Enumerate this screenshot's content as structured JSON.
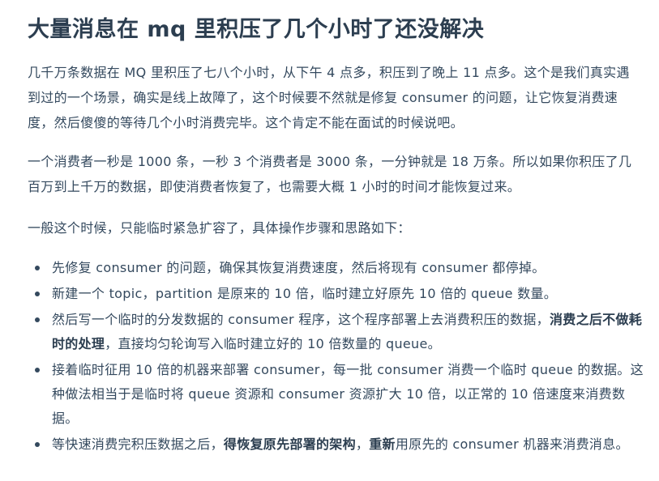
{
  "title": "大量消息在 mq 里积压了几个小时了还没解决",
  "paragraphs": [
    "几千万条数据在 MQ 里积压了七八个小时，从下午 4 点多，积压到了晚上 11 点多。这个是我们真实遇到过的一个场景，确实是线上故障了，这个时候要不然就是修复 consumer 的问题，让它恢复消费速度，然后傻傻的等待几个小时消费完毕。这个肯定不能在面试的时候说吧。",
    "一个消费者一秒是 1000 条，一秒 3 个消费者是 3000 条，一分钟就是 18 万条。所以如果你积压了几百万到上千万的数据，即使消费者恢复了，也需要大概 1 小时的时间才能恢复过来。",
    "一般这个时候，只能临时紧急扩容了，具体操作步骤和思路如下："
  ],
  "list": [
    {
      "before": "先修复 consumer 的问题，确保其恢复消费速度，然后将现有 consumer 都停掉。",
      "bold": "",
      "after": "",
      "bold2": "",
      "after2": ""
    },
    {
      "before": "新建一个 topic，partition 是原来的 10 倍，临时建立好原先 10 倍的 queue 数量。",
      "bold": "",
      "after": "",
      "bold2": "",
      "after2": ""
    },
    {
      "before": "然后写一个临时的分发数据的 consumer 程序，这个程序部署上去消费积压的数据，",
      "bold": "消费之后不做耗时的处理",
      "after": "，直接均匀轮询写入临时建立好的 10 倍数量的 queue。",
      "bold2": "",
      "after2": ""
    },
    {
      "before": "接着临时征用 10 倍的机器来部署 consumer，每一批 consumer 消费一个临时 queue 的数据。这种做法相当于是临时将 queue 资源和 consumer 资源扩大 10 倍，以正常的 10 倍速度来消费数据。",
      "bold": "",
      "after": "",
      "bold2": "",
      "after2": ""
    },
    {
      "before": "等快速消费完积压数据之后，",
      "bold": "得恢复原先部署的架构",
      "after": "，",
      "bold2": "重新",
      "after2": "用原先的 consumer 机器来消费消息。"
    }
  ]
}
